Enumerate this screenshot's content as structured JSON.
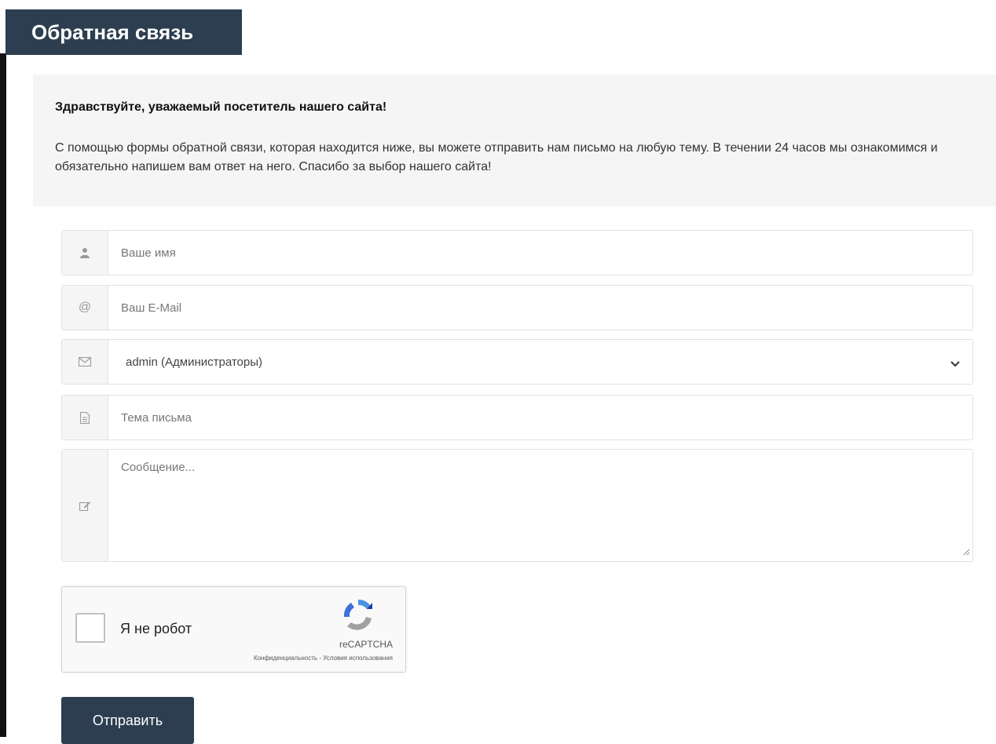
{
  "header": {
    "title": "Обратная связь"
  },
  "intro": {
    "greeting": "Здравствуйте, уважаемый посетитель нашего сайта!",
    "text": "С помощью формы обратной связи, которая находится ниже, вы можете отправить нам письмо на любую тему. В течении 24 часов мы ознакомимся и обязательно напишем вам ответ на него. Спасибо за выбор нашего сайта!"
  },
  "form": {
    "name_placeholder": "Ваше имя",
    "email_placeholder": "Ваш E-Mail",
    "recipient_selected": "admin (Администраторы)",
    "subject_placeholder": "Тема письма",
    "message_placeholder": "Сообщение...",
    "icons": {
      "name": "user-icon",
      "email": "at-icon",
      "recipient": "envelope-icon",
      "subject": "document-icon",
      "message": "edit-icon"
    }
  },
  "captcha": {
    "label": "Я не робот",
    "brand": "reCAPTCHA",
    "links": "Конфиденциальность - Условия использования"
  },
  "submit_label": "Отправить",
  "colors": {
    "accent": "#2c3e50",
    "panel": "#f5f5f5",
    "border": "#e2e2e2"
  }
}
